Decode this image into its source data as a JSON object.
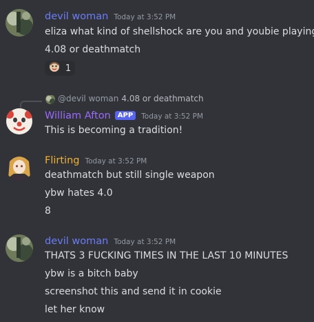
{
  "messages": [
    {
      "author": "devil woman",
      "author_color": "#5865f2",
      "timestamp": "Today at 3:52 PM",
      "lines": [
        "eliza what kind of shellshock are you and youbie playing",
        "4.08 or deathmatch"
      ],
      "reaction": {
        "emoji": "face-emoji",
        "count": "1"
      }
    },
    {
      "reply": {
        "mention": "@devil woman",
        "text": "4.08 or deathmatch"
      },
      "author": "William Afton",
      "author_color": "#8f63ff",
      "badge": "APP",
      "timestamp": "Today at 3:52 PM",
      "lines": [
        "This is becoming a tradition!"
      ]
    },
    {
      "author": "Flirting",
      "author_color": "#f0b232",
      "timestamp": "Today at 3:52 PM",
      "lines": [
        "deathmatch but still single weapon",
        "ybw hates 4.0",
        "8"
      ]
    },
    {
      "author": "devil woman",
      "author_color": "#5865f2",
      "timestamp": "Today at 3:52 PM",
      "lines": [
        "THATS 3 FUCKING TIMES IN THE LAST 10 MINUTES",
        "ybw is a bitch baby",
        "screenshot this and send it in cookie",
        "let her know"
      ]
    }
  ]
}
